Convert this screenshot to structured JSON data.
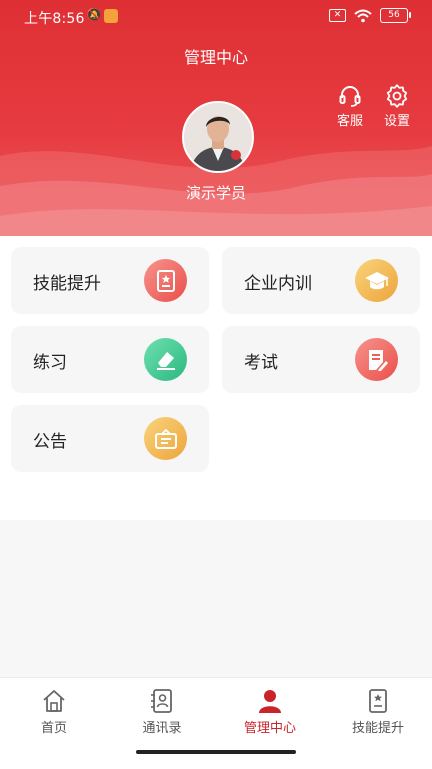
{
  "status_bar": {
    "time": "上午8:56",
    "battery": "56"
  },
  "header": {
    "title": "管理中心",
    "customer_service_label": "客服",
    "settings_label": "设置",
    "username": "演示学员"
  },
  "menu": [
    {
      "label": "技能提升",
      "icon": "skill-badge-icon",
      "color": "red"
    },
    {
      "label": "企业内训",
      "icon": "graduation-cap-icon",
      "color": "gold"
    },
    {
      "label": "练习",
      "icon": "eraser-icon",
      "color": "green"
    },
    {
      "label": "考试",
      "icon": "exam-paper-icon",
      "color": "red"
    },
    {
      "label": "公告",
      "icon": "notice-board-icon",
      "color": "gold"
    }
  ],
  "bottom_nav": [
    {
      "label": "首页",
      "icon": "home-icon",
      "active": false
    },
    {
      "label": "通讯录",
      "icon": "contacts-icon",
      "active": false
    },
    {
      "label": "管理中心",
      "icon": "user-icon",
      "active": true
    },
    {
      "label": "技能提升",
      "icon": "skill-badge-icon",
      "active": false
    }
  ],
  "colors": {
    "primary_red": "#de3034",
    "active_nav": "#c9242a"
  }
}
